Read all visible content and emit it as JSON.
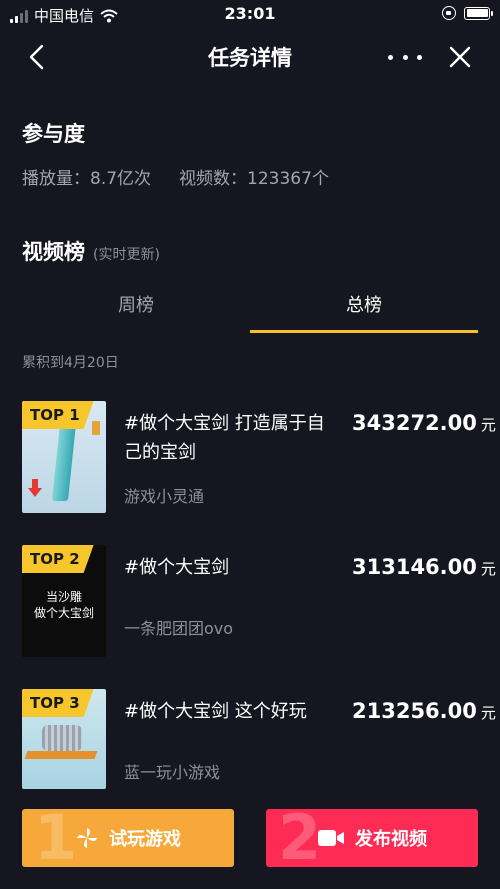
{
  "status_bar": {
    "carrier": "中国电信",
    "time": "23:01"
  },
  "nav": {
    "title": "任务详情"
  },
  "participation": {
    "title": "参与度",
    "plays": "播放量：8.7亿次",
    "videos": "视频数：123367个"
  },
  "ranking": {
    "title": "视频榜",
    "subtitle": "(实时更新)",
    "tabs": {
      "week": "周榜",
      "total": "总榜"
    },
    "selected_tab": "total",
    "cumulative": "累积到4月20日",
    "items": [
      {
        "badge": "TOP 1",
        "title": "#做个大宝剑 打造属于自己的宝剑",
        "author": "游戏小灵通",
        "amount": "343272.00",
        "unit": "元"
      },
      {
        "badge": "TOP 2",
        "thumb_text": "当沙雕\n做个大宝剑",
        "title": "#做个大宝剑",
        "author": "一条肥团团ovo",
        "amount": "313146.00",
        "unit": "元"
      },
      {
        "badge": "TOP 3",
        "title": "#做个大宝剑 这个好玩",
        "author": "蓝一玩小游戏",
        "amount": "213256.00",
        "unit": "元"
      }
    ]
  },
  "actions": {
    "play": {
      "step": "1",
      "label": "试玩游戏",
      "color": "#f6a93a"
    },
    "publish": {
      "step": "2",
      "label": "发布视频",
      "color": "#fe2c55"
    }
  },
  "colors": {
    "background": "#15161f",
    "accent": "#f6c02b",
    "muted_text": "#8e8f98"
  }
}
